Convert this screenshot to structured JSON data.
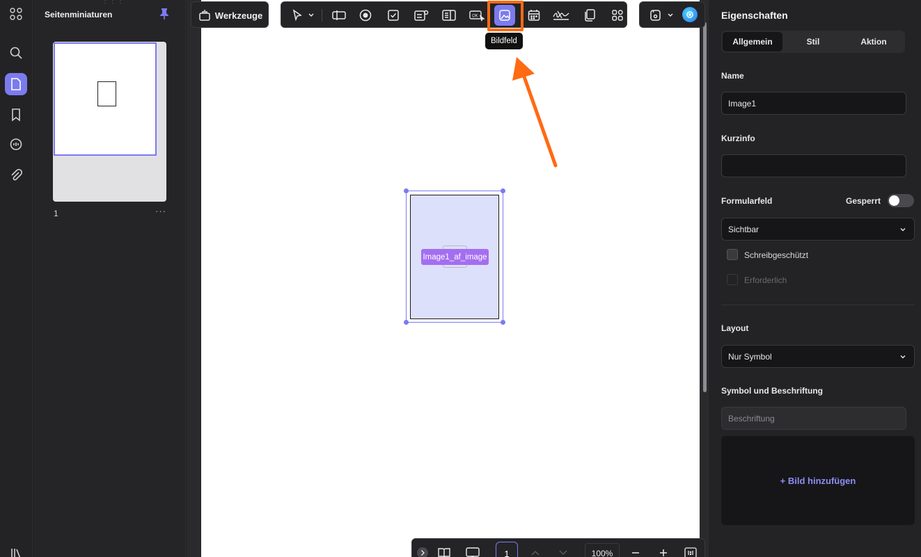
{
  "thumbnails": {
    "title": "Seitenminiaturen",
    "page_number": "1",
    "more": "···"
  },
  "toolbar": {
    "tools_label": "Werkzeuge",
    "tooltip": "Bildfeld"
  },
  "field": {
    "label": "Image1_af_image"
  },
  "bottom": {
    "page": "1",
    "zoom": "100%"
  },
  "properties": {
    "title": "Eigenschaften",
    "tabs": [
      "Allgemein",
      "Stil",
      "Aktion"
    ],
    "name_label": "Name",
    "name_value": "Image1",
    "tooltip_label": "Kurzinfo",
    "tooltip_value": "",
    "form_field_label": "Formularfeld",
    "locked_label": "Gesperrt",
    "visibility_value": "Sichtbar",
    "readonly_label": "Schreibgeschützt",
    "required_label": "Erforderlich",
    "layout_label": "Layout",
    "layout_value": "Nur Symbol",
    "symbol_label": "Symbol und Beschriftung",
    "caption_placeholder": "Beschriftung",
    "add_image": "+ Bild hinzufügen"
  },
  "colors": {
    "accent": "#7b7bf0",
    "highlight": "#ff6a13",
    "field_fill": "#dde0fb",
    "field_label": "#a46ef0"
  }
}
